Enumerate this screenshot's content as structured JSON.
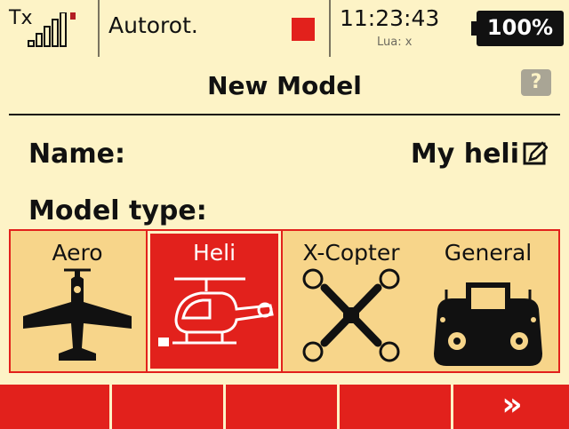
{
  "status_bar": {
    "tx_label": "Tx",
    "mode": "Autorot.",
    "time": "11:23:43",
    "lua": "Lua: x",
    "battery": "100%",
    "record_color": "#e2211c"
  },
  "screen": {
    "title": "New Model",
    "help_glyph": "?",
    "name_label": "Name:",
    "name_value": "My heli",
    "model_type_label": "Model type:"
  },
  "model_types": [
    {
      "label": "Aero",
      "icon": "airplane-icon",
      "selected": false
    },
    {
      "label": "Heli",
      "icon": "helicopter-icon",
      "selected": true
    },
    {
      "label": "X-Copter",
      "icon": "quadcopter-icon",
      "selected": false
    },
    {
      "label": "General",
      "icon": "transmitter-icon",
      "selected": false
    }
  ],
  "function_keys": {
    "next_glyph": "»"
  },
  "colors": {
    "background": "#fdf3c6",
    "accent_red": "#e2211c",
    "tile_bg": "#f7d58a"
  }
}
